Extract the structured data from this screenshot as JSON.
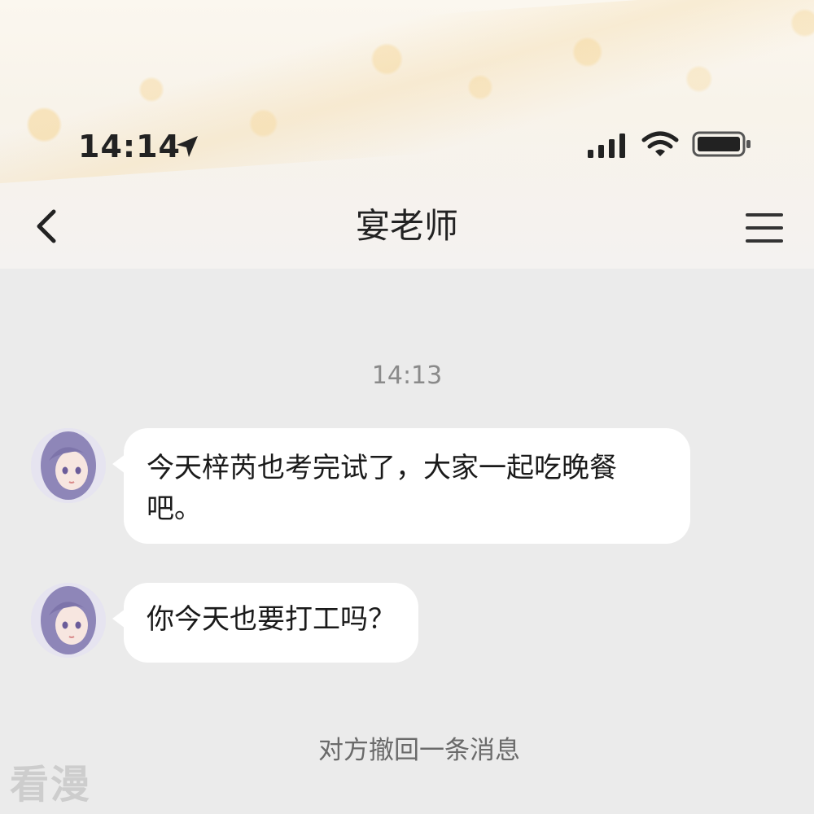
{
  "status_bar": {
    "time": "14:14",
    "location_icon": "location-arrow-icon",
    "signal_icon": "cellular-signal-icon",
    "wifi_icon": "wifi-icon",
    "battery_icon": "battery-icon"
  },
  "nav": {
    "back_icon": "chevron-left-icon",
    "title": "宴老师",
    "menu_icon": "hamburger-menu-icon"
  },
  "chat": {
    "timestamp": "14:13",
    "messages": [
      {
        "sender": "宴老师",
        "text": "今天梓芮也考完试了，大家一起吃晚餐吧。"
      },
      {
        "sender": "宴老师",
        "text": "你今天也要打工吗？"
      }
    ],
    "system_notice": "对方撤回一条消息"
  },
  "watermark": "看漫",
  "colors": {
    "chat_background": "#ebebeb",
    "bubble": "#ffffff",
    "header_background": "#f8f3ea",
    "text_primary": "#1a1a1a",
    "text_secondary": "#8a8a8a"
  }
}
